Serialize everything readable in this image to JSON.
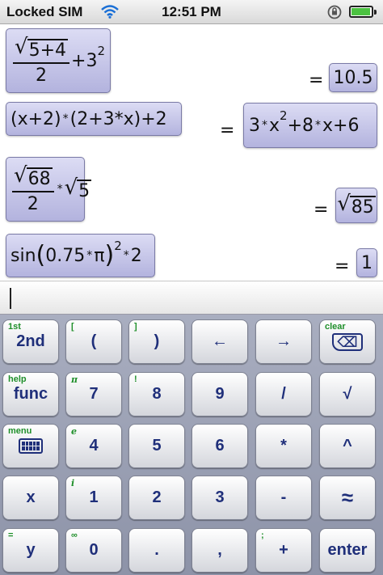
{
  "status_bar": {
    "carrier": "Locked SIM",
    "wifi_icon": "wifi-icon",
    "time": "12:51 PM",
    "lock_icon": "rotation-lock-icon",
    "battery_icon": "battery-icon"
  },
  "history": [
    {
      "expression": {
        "sqrt_inner": "5+4",
        "denominator": "2",
        "tail": "+3",
        "exponent": "2"
      },
      "equals": "=",
      "result": "10.5"
    },
    {
      "expression": {
        "left": "(x+2)",
        "op": "*",
        "right": "(2+3*x)",
        "tail": "+2"
      },
      "equals": "=",
      "result": {
        "a": "3",
        "b": "x",
        "exp": "2",
        "rest": "+8",
        "c": "x",
        "d": "+6"
      }
    },
    {
      "expression": {
        "sqrt_inner": "68",
        "denominator": "2",
        "op": "*",
        "sqrt2": "5"
      },
      "equals": "=",
      "result": {
        "sqrt_inner": "85"
      }
    },
    {
      "expression": {
        "fn": "sin",
        "arg_a": "0.75",
        "arg_b": "π",
        "exponent": "2",
        "tail": "2"
      },
      "equals": "=",
      "result": "1"
    }
  ],
  "input": {
    "value": ""
  },
  "keyboard": {
    "rows": [
      [
        {
          "label": "2nd",
          "alt": "1st"
        },
        {
          "label": "(",
          "alt": "["
        },
        {
          "label": ")",
          "alt": "]"
        },
        {
          "label": "←",
          "alt": ""
        },
        {
          "label": "→",
          "alt": ""
        },
        {
          "label": "⌫",
          "alt": "clear"
        }
      ],
      [
        {
          "label": "func",
          "alt": "help"
        },
        {
          "label": "7",
          "alt": "π"
        },
        {
          "label": "8",
          "alt": "!"
        },
        {
          "label": "9",
          "alt": ""
        },
        {
          "label": "/",
          "alt": ""
        },
        {
          "label": "√",
          "alt": ""
        }
      ],
      [
        {
          "label": "",
          "alt": "menu",
          "icon": "keyboard-icon"
        },
        {
          "label": "4",
          "alt": "e"
        },
        {
          "label": "5",
          "alt": ""
        },
        {
          "label": "6",
          "alt": ""
        },
        {
          "label": "*",
          "alt": ""
        },
        {
          "label": "^",
          "alt": ""
        }
      ],
      [
        {
          "label": "x",
          "alt": ""
        },
        {
          "label": "1",
          "alt": "i"
        },
        {
          "label": "2",
          "alt": ""
        },
        {
          "label": "3",
          "alt": ""
        },
        {
          "label": "-",
          "alt": ""
        },
        {
          "label": "≈",
          "alt": ""
        }
      ],
      [
        {
          "label": "y",
          "alt": "="
        },
        {
          "label": "0",
          "alt": "∞"
        },
        {
          "label": ".",
          "alt": ""
        },
        {
          "label": ",",
          "alt": ""
        },
        {
          "label": "+",
          "alt": ";"
        },
        {
          "label": "enter",
          "alt": ""
        }
      ]
    ]
  },
  "colors": {
    "key_text": "#1f2f7a",
    "alt_text": "#1f8f2a",
    "bubble": "#c4c4ea"
  }
}
